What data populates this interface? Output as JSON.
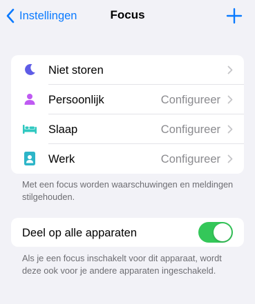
{
  "navbar": {
    "back_label": "Instellingen",
    "title": "Focus",
    "add_icon": "plus-icon"
  },
  "focus_modes": [
    {
      "label": "Niet storen",
      "value": "",
      "icon": "moon-icon",
      "icon_color": "#5e5ce6"
    },
    {
      "label": "Persoonlijk",
      "value": "Configureer",
      "icon": "person-icon",
      "icon_color": "#bf5af2"
    },
    {
      "label": "Slaap",
      "value": "Configureer",
      "icon": "bed-icon",
      "icon_color": "#30c8c0"
    },
    {
      "label": "Werk",
      "value": "Configureer",
      "icon": "badge-icon",
      "icon_color": "#2db5c8"
    }
  ],
  "focus_footnote": "Met een focus worden waarschuwingen en meldingen stilgehouden.",
  "share": {
    "label": "Deel op alle apparaten",
    "enabled": true,
    "footnote": "Als je een focus inschakelt voor dit apparaat, wordt deze ook voor je andere apparaten ingeschakeld."
  },
  "colors": {
    "accent": "#0a7aff",
    "toggle_on": "#34c759",
    "background": "#f2f2f7"
  }
}
